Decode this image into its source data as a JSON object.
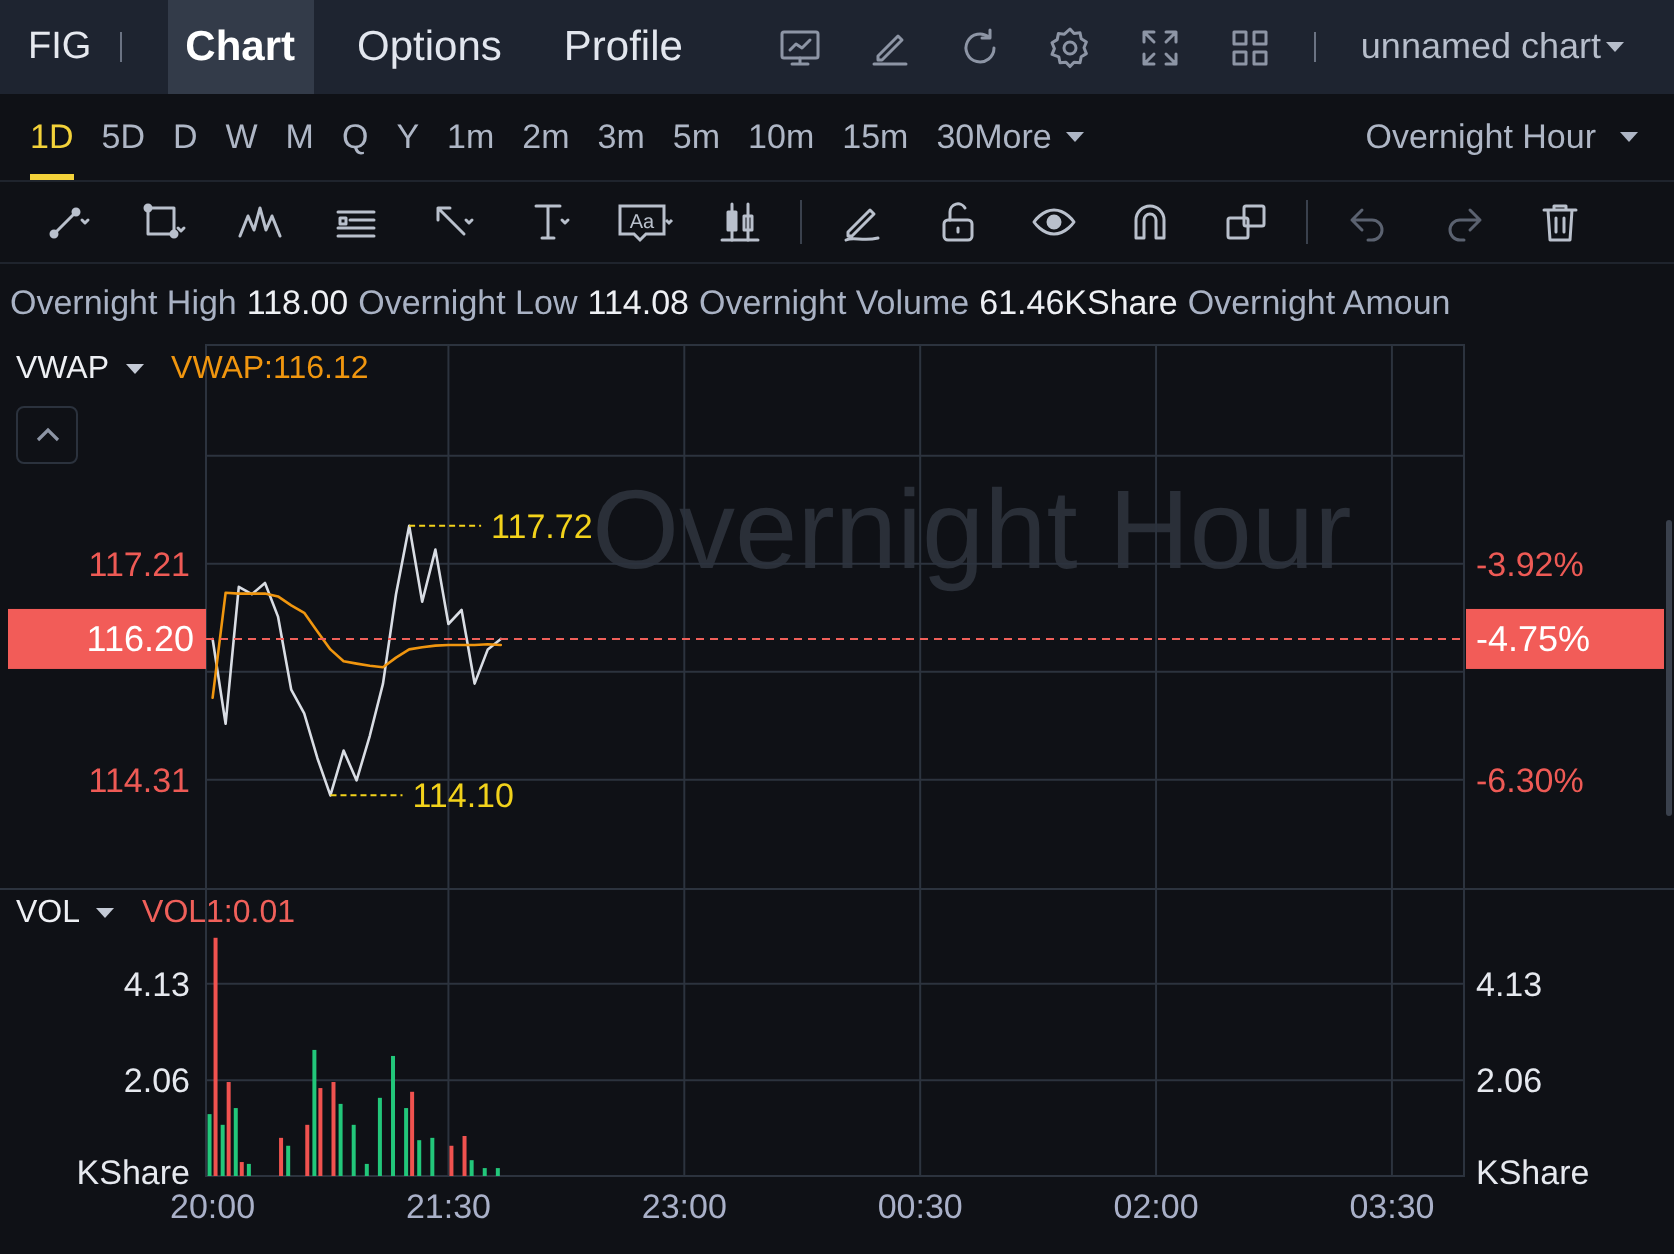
{
  "top_bar": {
    "symbol": "FIG",
    "tabs": [
      {
        "label": "Chart",
        "selected": true
      },
      {
        "label": "Options",
        "selected": false
      },
      {
        "label": "Profile",
        "selected": false
      }
    ],
    "layout_menu": "unnamed chart"
  },
  "timeframes": [
    {
      "label": "1D",
      "selected": true
    },
    {
      "label": "5D",
      "selected": false
    },
    {
      "label": "D",
      "selected": false
    },
    {
      "label": "W",
      "selected": false
    },
    {
      "label": "M",
      "selected": false
    },
    {
      "label": "Q",
      "selected": false
    },
    {
      "label": "Y",
      "selected": false
    },
    {
      "label": "1m",
      "selected": false
    },
    {
      "label": "2m",
      "selected": false
    },
    {
      "label": "3m",
      "selected": false
    },
    {
      "label": "5m",
      "selected": false
    },
    {
      "label": "10m",
      "selected": false
    },
    {
      "label": "15m",
      "selected": false
    },
    {
      "label": "30",
      "selected": false
    }
  ],
  "more_menu": "More",
  "session_menu": "Overnight Hour",
  "drawing_toolbar": {
    "text_tool_label": "Aa",
    "history": [
      {
        "kind": "undo",
        "disabled": true
      },
      {
        "kind": "redo",
        "disabled": true
      }
    ]
  },
  "stats": [
    {
      "label": "Overnight High",
      "value": "118.00"
    },
    {
      "label": "Overnight Low",
      "value": "114.08"
    },
    {
      "label": "Overnight Volume",
      "value": "61.46KShare"
    },
    {
      "label": "Overnight Amoun"
    }
  ],
  "price_pane": {
    "indicator_value": "VWAP:116.12",
    "session_watermark": "Overnight Hour",
    "last_price_tag": "116.20",
    "last_change_tag": "-4.75%",
    "right_axis_labels": [
      "-3.92%",
      "-6.30%"
    ],
    "high_marker": "117.72",
    "low_marker": "114.10",
    "chart_data": {
      "type": "line",
      "grid": true,
      "ref_lines": [
        {
          "axis": "y",
          "value": 116.2
        }
      ],
      "ylim": [
        112.91,
        120.16
      ],
      "yticks": [
        {
          "value": 117.21,
          "label": "117.21"
        },
        {
          "value": 114.31,
          "label": "114.31"
        }
      ],
      "categories": [
        null,
        null,
        null,
        null,
        null,
        null,
        null,
        null,
        null,
        null,
        null,
        null,
        null,
        null,
        null,
        null,
        null,
        null,
        null,
        null,
        null,
        null,
        null,
        null,
        null,
        null,
        null,
        null,
        null,
        null,
        null,
        null,
        null,
        null,
        null,
        null,
        null,
        null,
        null,
        null,
        null,
        null,
        null,
        null,
        null,
        null,
        null,
        null,
        null,
        null,
        null,
        null,
        null,
        null,
        null,
        null,
        null,
        null,
        null,
        null,
        null,
        null,
        null,
        null,
        null,
        null,
        null,
        null,
        null,
        null,
        null,
        null,
        null,
        null,
        null,
        null,
        null,
        null,
        null,
        null,
        null,
        null,
        null,
        null,
        null,
        null,
        null,
        null,
        null,
        null,
        null,
        null,
        null,
        null,
        null,
        null
      ],
      "series": [
        {
          "color": "#d9dde4",
          "values": [
            116.2,
            115.06,
            116.9,
            116.8,
            116.95,
            116.5,
            115.52,
            115.2,
            114.6,
            114.1,
            114.7,
            114.3,
            114.9,
            115.6,
            116.8,
            117.72,
            116.7,
            117.4,
            116.4,
            116.59,
            115.6,
            116.06,
            116.2,
            null,
            null,
            null,
            null,
            null,
            null,
            null,
            null,
            null,
            null,
            null,
            null,
            null,
            null,
            null,
            null,
            null,
            null,
            null,
            null,
            null,
            null,
            null,
            null,
            null,
            null,
            null,
            null,
            null,
            null,
            null,
            null,
            null,
            null,
            null,
            null,
            null,
            null,
            null,
            null,
            null,
            null,
            null,
            null,
            null,
            null,
            null,
            null,
            null,
            null,
            null,
            null,
            null,
            null,
            null,
            null,
            null,
            null,
            null,
            null,
            null,
            null,
            null,
            null,
            null,
            null,
            null,
            null,
            null,
            null,
            null,
            null,
            null
          ]
        },
        {
          "name": "VWAP",
          "color": "#f0960f",
          "values": [
            115.41,
            116.82,
            116.81,
            116.81,
            116.81,
            116.77,
            116.65,
            116.55,
            116.3,
            116.06,
            115.9,
            115.87,
            115.84,
            115.82,
            115.95,
            116.06,
            116.09,
            116.11,
            116.12,
            116.12,
            116.12,
            116.13,
            116.12,
            null,
            null,
            null,
            null,
            null,
            null,
            null,
            null,
            null,
            null,
            null,
            null,
            null,
            null,
            null,
            null,
            null,
            null,
            null,
            null,
            null,
            null,
            null,
            null,
            null,
            null,
            null,
            null,
            null,
            null,
            null,
            null,
            null,
            null,
            null,
            null,
            null,
            null,
            null,
            null,
            null,
            null,
            null,
            null,
            null,
            null,
            null,
            null,
            null,
            null,
            null,
            null,
            null,
            null,
            null,
            null,
            null,
            null,
            null,
            null,
            null,
            null,
            null,
            null,
            null,
            null,
            null,
            null,
            null,
            null,
            null,
            null,
            null
          ]
        }
      ]
    }
  },
  "volume_pane": {
    "indicator": "VOL",
    "indicator_value": "VOL1:0.01",
    "right_axis_labels": [
      "4.13",
      "2.06",
      "KShare"
    ],
    "chart_data": {
      "type": "bar",
      "stacked": false,
      "grid": true,
      "ylim": [
        0,
        6.19
      ],
      "yticks": [
        {
          "value": 4.13,
          "label": "4.13"
        },
        {
          "value": 2.06,
          "label": "2.06"
        },
        {
          "value": 0,
          "label": "KShare"
        }
      ],
      "categories": [
        "20:00",
        null,
        null,
        null,
        null,
        null,
        null,
        null,
        null,
        null,
        null,
        null,
        null,
        null,
        null,
        null,
        null,
        null,
        "21:30",
        null,
        null,
        null,
        null,
        null,
        null,
        null,
        null,
        null,
        null,
        null,
        null,
        null,
        null,
        null,
        null,
        null,
        "23:00",
        null,
        null,
        null,
        null,
        null,
        null,
        null,
        null,
        null,
        null,
        null,
        null,
        null,
        null,
        null,
        null,
        null,
        "00:30",
        null,
        null,
        null,
        null,
        null,
        null,
        null,
        null,
        null,
        null,
        null,
        null,
        null,
        null,
        null,
        null,
        null,
        "02:00",
        null,
        null,
        null,
        null,
        null,
        null,
        null,
        null,
        null,
        null,
        null,
        null,
        null,
        null,
        null,
        null,
        null,
        "03:30",
        null,
        null,
        null,
        null,
        null
      ],
      "series": [
        {
          "color": "#22c77a",
          "values": [
            1.33,
            1.1,
            1.46,
            0.26,
            null,
            null,
            0.65,
            null,
            2.71,
            null,
            1.55,
            1.1,
            0.26,
            1.68,
            2.58,
            1.46,
            0.77,
            0.82,
            null,
            null,
            0.34,
            0.17,
            0.17,
            null,
            null,
            null,
            null,
            null,
            null,
            null,
            null,
            null,
            null,
            null,
            null,
            null,
            null,
            null,
            null,
            null,
            null,
            null,
            null,
            null,
            null,
            null,
            null,
            null,
            null,
            null,
            null,
            null,
            null,
            null,
            null,
            null,
            null,
            null,
            null,
            null,
            null,
            null,
            null,
            null,
            null,
            null,
            null,
            null,
            null,
            null,
            null,
            null,
            null,
            null,
            null,
            null,
            null,
            null,
            null,
            null,
            null,
            null,
            null,
            null,
            null,
            null,
            null,
            null,
            null,
            null,
            null,
            null,
            null,
            null,
            null,
            null
          ]
        },
        {
          "color": "#f0524f",
          "values": [
            5.12,
            2.02,
            0.3,
            null,
            null,
            0.82,
            null,
            1.1,
            1.89,
            2.02,
            null,
            null,
            null,
            null,
            null,
            1.81,
            null,
            null,
            0.65,
            0.86,
            null,
            null,
            null,
            null,
            null,
            null,
            null,
            null,
            null,
            null,
            null,
            null,
            null,
            null,
            null,
            null,
            null,
            null,
            null,
            null,
            null,
            null,
            null,
            null,
            null,
            null,
            null,
            null,
            null,
            null,
            null,
            null,
            null,
            null,
            null,
            null,
            null,
            null,
            null,
            null,
            null,
            null,
            null,
            null,
            null,
            null,
            null,
            null,
            null,
            null,
            null,
            null,
            null,
            null,
            null,
            null,
            null,
            null,
            null,
            null,
            null,
            null,
            null,
            null,
            null,
            null,
            null,
            null,
            null,
            null,
            null,
            null,
            null,
            null,
            null,
            null
          ]
        }
      ]
    }
  }
}
